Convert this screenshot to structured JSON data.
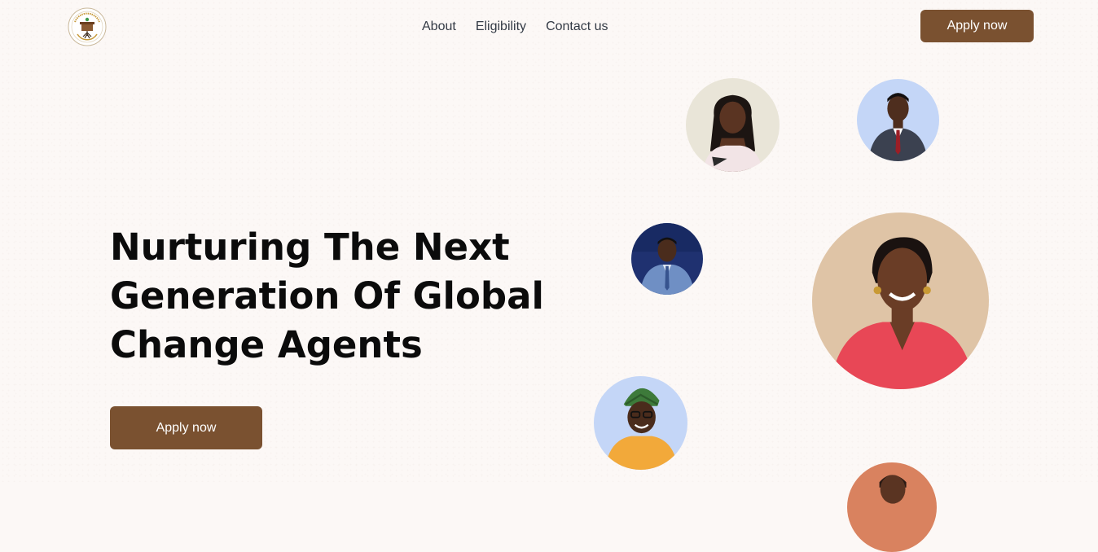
{
  "header": {
    "logo_icon": "fellowship-seal-logo",
    "nav": [
      {
        "label": "About"
      },
      {
        "label": "Eligibility"
      },
      {
        "label": "Contact us"
      }
    ],
    "cta_label": "Apply now"
  },
  "hero": {
    "title": "Nurturing The Next Generation Of Global Change Agents",
    "cta_label": "Apply now"
  },
  "colors": {
    "brand": "#7a5130",
    "background": "#fcf8f6",
    "title": "#0b0b0b",
    "nav_text": "#333a45"
  },
  "fellows": [
    {
      "name": "fellow-portrait-1",
      "bg": "#e9e5d8"
    },
    {
      "name": "fellow-portrait-2",
      "bg": "#c4d6f7"
    },
    {
      "name": "fellow-portrait-3",
      "bg": "#1f3170"
    },
    {
      "name": "fellow-portrait-4",
      "bg": "#dfc4a6"
    },
    {
      "name": "fellow-portrait-5",
      "bg": "#c4d6f7"
    },
    {
      "name": "fellow-portrait-6",
      "bg": "#d9825f"
    }
  ]
}
